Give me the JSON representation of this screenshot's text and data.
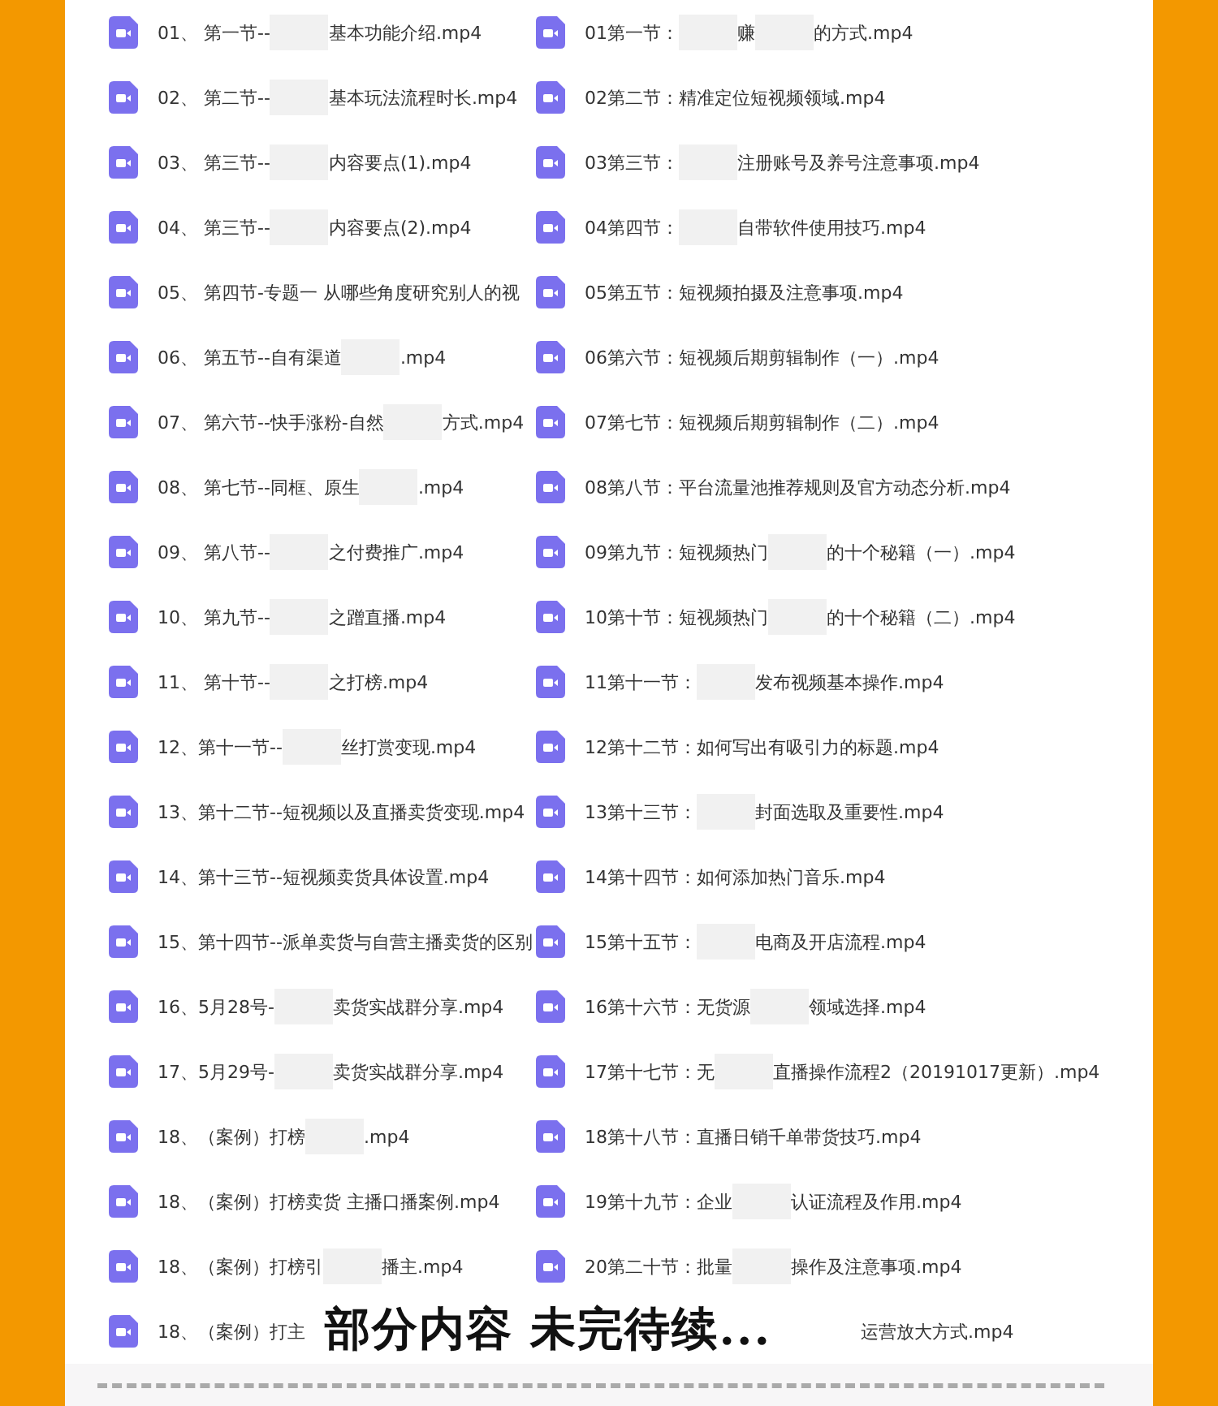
{
  "columns": [
    {
      "items": [
        {
          "parts": [
            "01、 第一节--",
            "基本功能介绍.mp4"
          ]
        },
        {
          "parts": [
            "02、 第二节--",
            "基本玩法流程时长.mp4"
          ]
        },
        {
          "parts": [
            "03、 第三节--",
            "内容要点(1).mp4"
          ]
        },
        {
          "parts": [
            "04、 第三节--",
            "内容要点(2).mp4"
          ]
        },
        {
          "parts": [
            "05、 第四节-专题一 从哪些角度研究别人的视"
          ]
        },
        {
          "parts": [
            "06、 第五节--自有渠道",
            ".mp4"
          ]
        },
        {
          "parts": [
            "07、 第六节--快手涨粉-自然",
            "方式.mp4"
          ]
        },
        {
          "parts": [
            "08、 第七节--同框、原生",
            ".mp4"
          ]
        },
        {
          "parts": [
            "09、 第八节--",
            "之付费推广.mp4"
          ]
        },
        {
          "parts": [
            "10、 第九节--",
            "之蹭直播.mp4"
          ]
        },
        {
          "parts": [
            "11、 第十节--",
            "之打榜.mp4"
          ]
        },
        {
          "parts": [
            "12、第十一节--",
            "丝打赏变现.mp4"
          ]
        },
        {
          "parts": [
            "13、第十二节--短视频以及直播卖货变现.mp4"
          ]
        },
        {
          "parts": [
            "14、第十三节--短视频卖货具体设置.mp4"
          ]
        },
        {
          "parts": [
            "15、第十四节--派单卖货与自营主播卖货的区别"
          ]
        },
        {
          "parts": [
            "16、5月28号-",
            "卖货实战群分享.mp4"
          ]
        },
        {
          "parts": [
            "17、5月29号-",
            "卖货实战群分享.mp4"
          ]
        },
        {
          "parts": [
            "18、（案例）打榜",
            ".mp4"
          ]
        },
        {
          "parts": [
            "18、（案例）打榜卖货 主播口播案例.mp4"
          ]
        },
        {
          "parts": [
            "18、（案例）打榜引",
            "播主.mp4"
          ]
        },
        {
          "parts": [
            "18、（案例）打主"
          ]
        }
      ]
    },
    {
      "items": [
        {
          "parts": [
            "01第一节：",
            "赚",
            "的方式.mp4"
          ]
        },
        {
          "parts": [
            "02第二节：精准定位短视频领域.mp4"
          ]
        },
        {
          "parts": [
            "03第三节：",
            "注册账号及养号注意事项.mp4"
          ]
        },
        {
          "parts": [
            "04第四节：",
            "自带软件使用技巧.mp4"
          ]
        },
        {
          "parts": [
            "05第五节：短视频拍摄及注意事项.mp4"
          ]
        },
        {
          "parts": [
            "06第六节：短视频后期剪辑制作（一）.mp4"
          ]
        },
        {
          "parts": [
            "07第七节：短视频后期剪辑制作（二）.mp4"
          ]
        },
        {
          "parts": [
            "08第八节：平台流量池推荐规则及官方动态分析.mp4"
          ]
        },
        {
          "parts": [
            "09第九节：短视频热门",
            "的十个秘籍（一）.mp4"
          ]
        },
        {
          "parts": [
            "10第十节：短视频热门",
            "的十个秘籍（二）.mp4"
          ]
        },
        {
          "parts": [
            "11第十一节：",
            "发布视频基本操作.mp4"
          ]
        },
        {
          "parts": [
            "12第十二节：如何写出有吸引力的标题.mp4"
          ]
        },
        {
          "parts": [
            "13第十三节：",
            "封面选取及重要性.mp4"
          ]
        },
        {
          "parts": [
            "14第十四节：如何添加热门音乐.mp4"
          ]
        },
        {
          "parts": [
            "15第十五节：",
            "电商及开店流程.mp4"
          ]
        },
        {
          "parts": [
            "16第十六节：无货源",
            "领域选择.mp4"
          ]
        },
        {
          "parts": [
            "17第十七节：无",
            "直播操作流程2（20191017更新）.mp4"
          ]
        },
        {
          "parts": [
            "18第十八节：直播日销千单带货技巧.mp4"
          ]
        },
        {
          "parts": [
            "19第十九节：企业",
            "认证流程及作用.mp4"
          ]
        },
        {
          "parts": [
            "20第二十节：批量",
            "操作及注意事项.mp4"
          ]
        },
        {
          "parts": [
            "运营放大方式.mp4"
          ],
          "covered": true
        }
      ]
    }
  ],
  "banner": "部分内容 未完待续..."
}
